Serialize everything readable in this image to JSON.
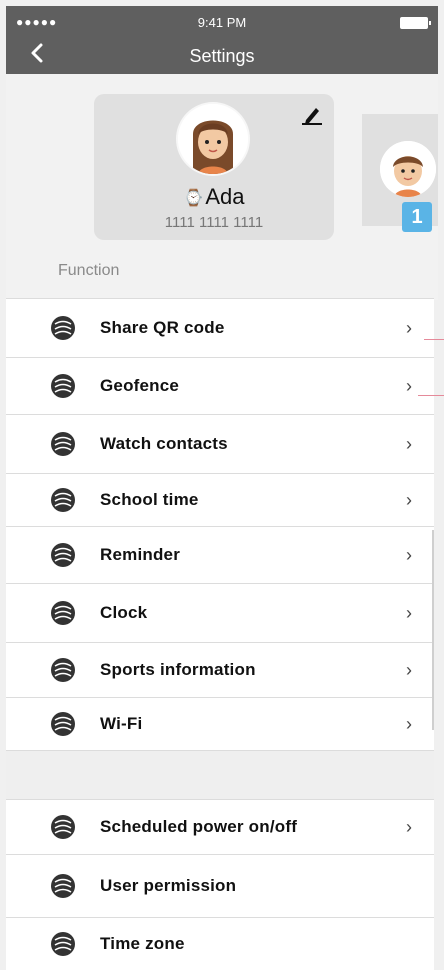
{
  "status": {
    "signal": "●●●●● ",
    "time": "9:41 PM"
  },
  "nav": {
    "title": "Settings"
  },
  "profile": {
    "name": "Ada",
    "number": "1111 1111 1111",
    "watch_glyph": "⌚",
    "badge": "1"
  },
  "section": {
    "label": "Function"
  },
  "menu": [
    {
      "label": "Share QR code",
      "chevron": "›"
    },
    {
      "label": "Geofence",
      "chevron": "›"
    },
    {
      "label": "Watch contacts",
      "chevron": "›"
    },
    {
      "label": "School time",
      "chevron": "›"
    },
    {
      "label": "Reminder",
      "chevron": "›"
    },
    {
      "label": "Clock",
      "chevron": "›"
    },
    {
      "label": "Sports information",
      "chevron": "›"
    },
    {
      "label": "Wi-Fi",
      "chevron": "›"
    },
    {
      "label": "Scheduled power on/off",
      "chevron": "›"
    },
    {
      "label": "User permission",
      "chevron": ""
    },
    {
      "label": "Time zone",
      "chevron": ""
    }
  ],
  "colors": {
    "nav_bg": "#5f5f5f",
    "badge_bg": "#5ab4e6",
    "accent_line": "#e58a9a"
  },
  "icons": {
    "menu_item": "swirl-icon",
    "back": "back-arrow-icon",
    "edit": "edit-pencil-icon"
  }
}
